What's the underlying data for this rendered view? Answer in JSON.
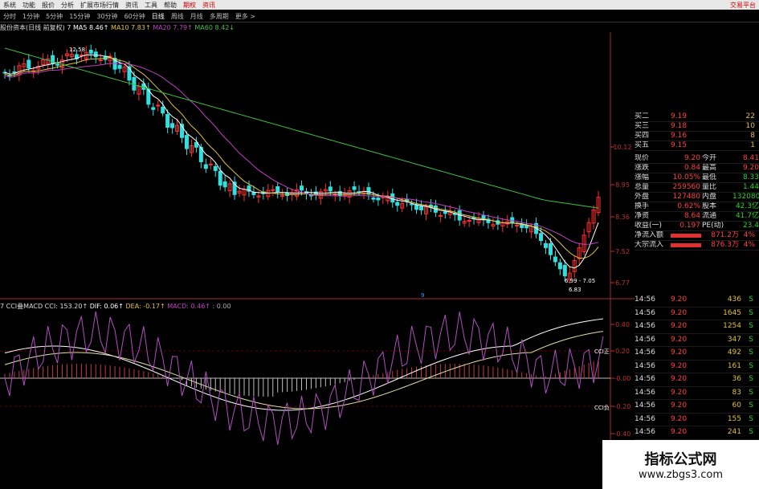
{
  "menu": [
    "系统",
    "功能",
    "报价",
    "分析",
    "扩展市场行情",
    "资讯",
    "工具",
    "帮助",
    "期权",
    "资讯"
  ],
  "menu_right": "交易平台",
  "periods": [
    "分时",
    "1分钟",
    "5分钟",
    "15分钟",
    "30分钟",
    "60分钟",
    "日线",
    "周线",
    "月线",
    "多周期",
    "更多 >"
  ],
  "active_period": "日线",
  "main_legend": {
    "name": "股份资本(日线 前复权) 7",
    "ma5": "MA5 8.46↑",
    "ma10": "MA10 7.83↑",
    "ma20": "MA20 7.79↑",
    "ma60": "MA60 8.42↓"
  },
  "ind_legend": {
    "name": "7 CCI叠MACD CCI: 153.20↑",
    "dif": "DIF: 0.06↑",
    "dea": "DEA: -0.17↑",
    "macd": "MACD: 0.46↑",
    "extra": ": 0.00"
  },
  "price_axis": [
    "10.12",
    "8.95",
    "8.36",
    "7.52",
    "6.77"
  ],
  "ind_axis": [
    "0.40",
    "0.20",
    "-0.00",
    "-0.20",
    "-0.40"
  ],
  "annotations": {
    "high": "12.58",
    "low_range": "6.99 - 7.05",
    "low": "6.83",
    "cci_up": "CCI正",
    "cci_down": "CCI负",
    "marker": "9"
  },
  "colors": {
    "up": "#ff3030",
    "down": "#30e0e0",
    "ma5": "#ffffff",
    "ma10": "#e0c040",
    "ma20": "#c040c0",
    "ma60": "#40c040"
  },
  "quote": {
    "book": [
      {
        "label": "买二",
        "price": "9.19",
        "vol": "22"
      },
      {
        "label": "买三",
        "price": "9.18",
        "vol": "10"
      },
      {
        "label": "买四",
        "price": "9.16",
        "vol": "8"
      },
      {
        "label": "买五",
        "price": "9.15",
        "vol": "1"
      }
    ],
    "stats": [
      {
        "l1": "现价",
        "v1": "9.20",
        "l2": "今开",
        "v2": "8.41"
      },
      {
        "l1": "涨跌",
        "v1": "0.84",
        "l2": "最高",
        "v2": "9.20"
      },
      {
        "l1": "涨幅",
        "v1": "10.05%",
        "l2": "最低",
        "v2": "8.33"
      },
      {
        "l1": "总量",
        "v1": "259560",
        "l2": "量比",
        "v2": "1.44"
      },
      {
        "l1": "外盘",
        "v1": "127480",
        "l2": "内盘",
        "v2": "132080"
      },
      {
        "l1": "换手",
        "v1": "0.62%",
        "l2": "股本",
        "v2": "42.3亿"
      },
      {
        "l1": "净资",
        "v1": "8.64",
        "l2": "流通",
        "v2": "41.7亿"
      },
      {
        "l1": "收益(一)",
        "v1": "0.197",
        "l2": "PE(动)",
        "v2": "23.4"
      }
    ],
    "flows": [
      {
        "label": "净流入额",
        "value": "871.2万",
        "pct": "4%"
      },
      {
        "label": "大宗流入",
        "value": "876.3万",
        "pct": "4%"
      }
    ]
  },
  "trades": [
    {
      "t": "14:56",
      "p": "9.20",
      "v": "436",
      "f": "S"
    },
    {
      "t": "14:56",
      "p": "9.20",
      "v": "1645",
      "f": "S"
    },
    {
      "t": "14:56",
      "p": "9.20",
      "v": "1254",
      "f": "S"
    },
    {
      "t": "14:56",
      "p": "9.20",
      "v": "347",
      "f": "S"
    },
    {
      "t": "14:56",
      "p": "9.20",
      "v": "492",
      "f": "S"
    },
    {
      "t": "14:56",
      "p": "9.20",
      "v": "161",
      "f": "S"
    },
    {
      "t": "14:56",
      "p": "9.20",
      "v": "36",
      "f": "S"
    },
    {
      "t": "14:56",
      "p": "9.20",
      "v": "83",
      "f": "S"
    },
    {
      "t": "14:56",
      "p": "9.20",
      "v": "60",
      "f": "S"
    },
    {
      "t": "14:56",
      "p": "9.20",
      "v": "155",
      "f": "S"
    },
    {
      "t": "14:56",
      "p": "9.20",
      "v": "241",
      "f": "S"
    },
    {
      "t": "14:56",
      "p": "9.20",
      "v": "213",
      "f": "S"
    },
    {
      "t": "14:56",
      "p": "9.20",
      "v": "",
      "f": ""
    }
  ],
  "watermark": {
    "title": "指标公式网",
    "url": "www.zbgs3.com"
  }
}
